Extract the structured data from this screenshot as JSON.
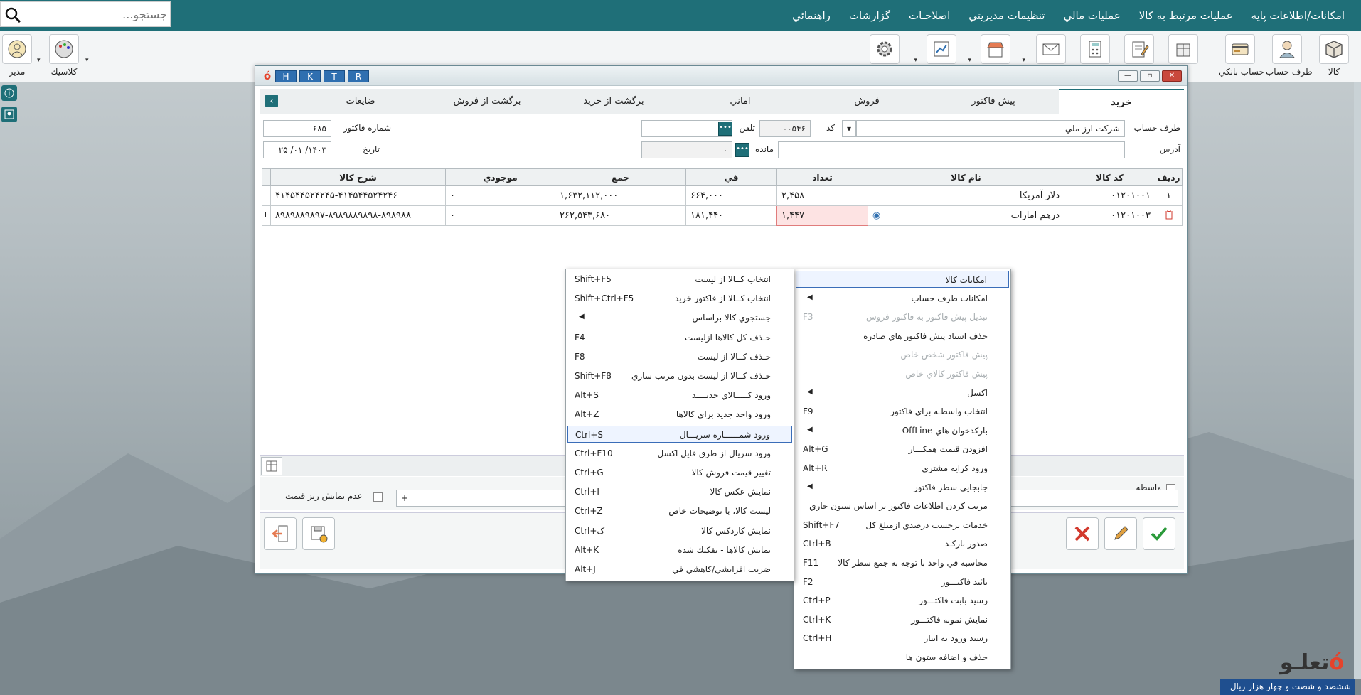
{
  "search": {
    "placeholder": "جستجو..."
  },
  "menu": [
    "امكانات/اطلاعات پايه",
    "عمليات مرتبط به كالا",
    "عمليات مالي",
    "تنظيمات مديريتي",
    "اصلاحـات",
    "گزارشات",
    "راهنمائي"
  ],
  "toolbar": {
    "right": [
      {
        "label": "كالا",
        "icon": "box-icon"
      },
      {
        "label": "طرف حساب",
        "icon": "person-icon"
      },
      {
        "label": "حساب بانكي",
        "icon": "bank-card-icon"
      }
    ],
    "left": [
      {
        "label": "مدير",
        "icon": "user-icon"
      },
      {
        "label": "كلاسيك",
        "icon": "palette-icon"
      }
    ]
  },
  "window": {
    "hotkeys": [
      "H",
      "K",
      "T",
      "R"
    ],
    "tabs": [
      "خريد",
      "پيش فاكتور",
      "فروش",
      "اماني",
      "برگشت از خريد",
      "برگشت از فروش",
      "ضايعات"
    ],
    "active_tab": "خريد",
    "form": {
      "account_label": "طرف حساب",
      "account_value": "شركت ارز ملي",
      "code_label": "كد",
      "code_value": "۰۰۵۴۶",
      "phone_label": "تلفن",
      "invoice_no_label": "شماره فاكتور",
      "invoice_no_value": "۶۸۵",
      "address_label": "آدرس",
      "balance_label": "مانده",
      "balance_value": "۰",
      "date_label": "تاريخ",
      "date_value": "۱۴۰۳/ ۰۱/ ۲۵"
    },
    "table": {
      "headers": [
        "رديف",
        "كد كالا",
        "نام كالا",
        "تعداد",
        "في",
        "جمع",
        "موجودي",
        "شرح كالا"
      ],
      "rows": [
        {
          "idx": "۱",
          "code": "۰۱۲۰۱۰۰۱",
          "name": "دلار آمريكا",
          "qty": "۲,۴۵۸",
          "price": "۶۶۴,۰۰۰",
          "total": "۱,۶۳۲,۱۱۲,۰۰۰",
          "stock": "۰",
          "desc": "۴۱۴۵۴۴۵۲۴۲۴۵-۴۱۴۵۴۴۵۲۴۲۴۶"
        },
        {
          "idx": "",
          "code": "۰۱۲۰۱۰۰۳",
          "name": "درهم امارات",
          "qty": "۱,۴۴۷",
          "price": "۱۸۱,۴۴۰",
          "total": "۲۶۲,۵۴۳,۶۸۰",
          "stock": "۰",
          "desc": "۸۹۸۹۸۸۹۸۹۷-۸۹۸۹۸۸۹۸۹۸-۸۹۸۹۸۸"
        }
      ]
    },
    "bottom": {
      "agent_label": "واسطه",
      "no_price_label": "عدم نمايش ريز قيمت",
      "plus": "+"
    }
  },
  "context_menu_right": [
    {
      "label": "امكانات كالا",
      "key": "",
      "selected": true
    },
    {
      "label": "امكانات طرف حساب",
      "key": "",
      "sub": true
    },
    {
      "label": "تبديل پيش فاكتور به فاكتور فروش",
      "key": "F3",
      "disabled": true
    },
    {
      "label": "حذف اسناد پيش فاكتور هاي صادره",
      "key": ""
    },
    {
      "label": "پيش فاكتور شخص خاص",
      "key": "",
      "disabled": true
    },
    {
      "label": "پيش فاكتور كالاي خاص",
      "key": "",
      "disabled": true
    },
    {
      "label": "اكسل",
      "key": "",
      "sub": true
    },
    {
      "label": "انتخاب واسطـه براي فاكتور",
      "key": "F9"
    },
    {
      "label": "باركدخوان هاي OffLine",
      "key": "",
      "sub": true
    },
    {
      "label": "افزودن قيمت همكـــار",
      "key": "Alt+G"
    },
    {
      "label": "ورود كرايه مشتري",
      "key": "Alt+R"
    },
    {
      "label": "جابجايي سطر فاكتور",
      "key": "",
      "sub": true
    },
    {
      "label": "مرتب كردن اطلاعات فاكتور بر اساس ستون جاري",
      "key": ""
    },
    {
      "label": "خدمات برحسب درصدي ازمبلغ كل",
      "key": "Shift+F7"
    },
    {
      "label": "صدور باركـد",
      "key": "Ctrl+B"
    },
    {
      "label": "محاسبه في واحد با توجه به جمع سطر كالا",
      "key": "F11"
    },
    {
      "label": "تائيد فاكتـــور",
      "key": "F2"
    },
    {
      "label": "رسيد بابت فاكتـــور",
      "key": "Ctrl+P"
    },
    {
      "label": "نمايش نمونه فاكتـــور",
      "key": "Ctrl+K"
    },
    {
      "label": "رسيد ورود به انبار",
      "key": "Ctrl+H"
    },
    {
      "label": "حذف و اضافه ستون ها",
      "key": ""
    }
  ],
  "context_menu_left": [
    {
      "label": "انتخاب كــالا از ليست",
      "key": "Shift+F5"
    },
    {
      "label": "انتخاب كــالا از فاكتور خريد",
      "key": "Shift+Ctrl+F5"
    },
    {
      "label": "جستجوي كالا براساس",
      "key": "",
      "sub": true
    },
    {
      "label": "حـذف كل كالاها ازليست",
      "key": "F4"
    },
    {
      "label": "حـذف كــالا از ليست",
      "key": "F8"
    },
    {
      "label": "حـذف كــالا از ليست بدون مرتب سازي",
      "key": "Shift+F8"
    },
    {
      "label": "ورود كـــــالاي جديــــد",
      "key": "Alt+S"
    },
    {
      "label": "ورود واحد جديد براي كالاها",
      "key": "Alt+Z"
    },
    {
      "label": "ورود شمــــــاره سريـــال",
      "key": "Ctrl+S",
      "selected": true
    },
    {
      "label": "ورود سريال از طرق فايل اكسل",
      "key": "Ctrl+F10"
    },
    {
      "label": "تغيير قيمت فروش كالا",
      "key": "Ctrl+G"
    },
    {
      "label": "نمايش عكس كالا",
      "key": "Ctrl+I"
    },
    {
      "label": "ليست كالا، با توضيحات خاص",
      "key": "Ctrl+Z"
    },
    {
      "label": "نمايش كاردكس كالا",
      "key": "Ctrl+ک"
    },
    {
      "label": "نمايش كالاها - تفكيك شده",
      "key": "Alt+K"
    },
    {
      "label": "ضريب افزايشي/كاهشي في",
      "key": "Alt+J"
    }
  ],
  "brand": {
    "text": "ششصد و شصت و چهار هزار  ريال",
    "logo_a": "تعلـو",
    "logo_b": "ó"
  },
  "colors": {
    "primary": "#1f6f78",
    "hotkey": "#2f6fb0",
    "confirm": "#2a9a3a",
    "cancel": "#d23a2e"
  }
}
